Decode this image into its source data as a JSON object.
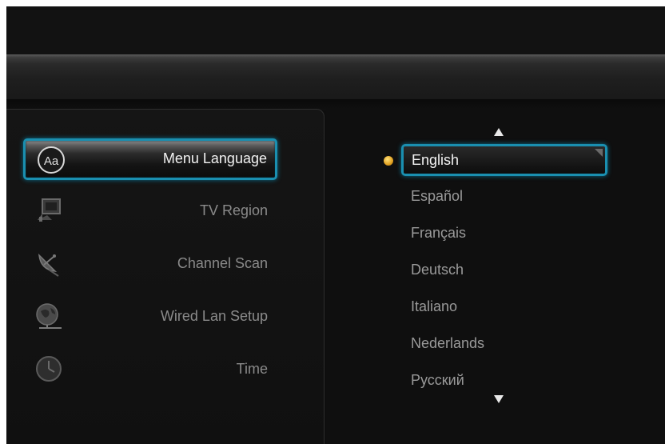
{
  "menu": {
    "items": [
      {
        "label": "Menu Language",
        "icon": "language-icon",
        "selected": true
      },
      {
        "label": "TV Region",
        "icon": "tv-region-icon",
        "selected": false
      },
      {
        "label": "Channel Scan",
        "icon": "satellite-dish-icon",
        "selected": false
      },
      {
        "label": "Wired Lan Setup",
        "icon": "globe-network-icon",
        "selected": false
      },
      {
        "label": "Time",
        "icon": "clock-icon",
        "selected": false
      }
    ],
    "language_icon_text": "Aa"
  },
  "languages": {
    "items": [
      "English",
      "Español",
      "Français",
      "Deutsch",
      "Italiano",
      "Nederlands",
      "Русский"
    ],
    "selected_index": 0,
    "scroll_up_icon": "arrow-up-icon",
    "scroll_down_icon": "arrow-down-icon"
  },
  "colors": {
    "accent": "#1a8fb0",
    "background": "#0e0e0e",
    "bullet": "#f0b030"
  }
}
